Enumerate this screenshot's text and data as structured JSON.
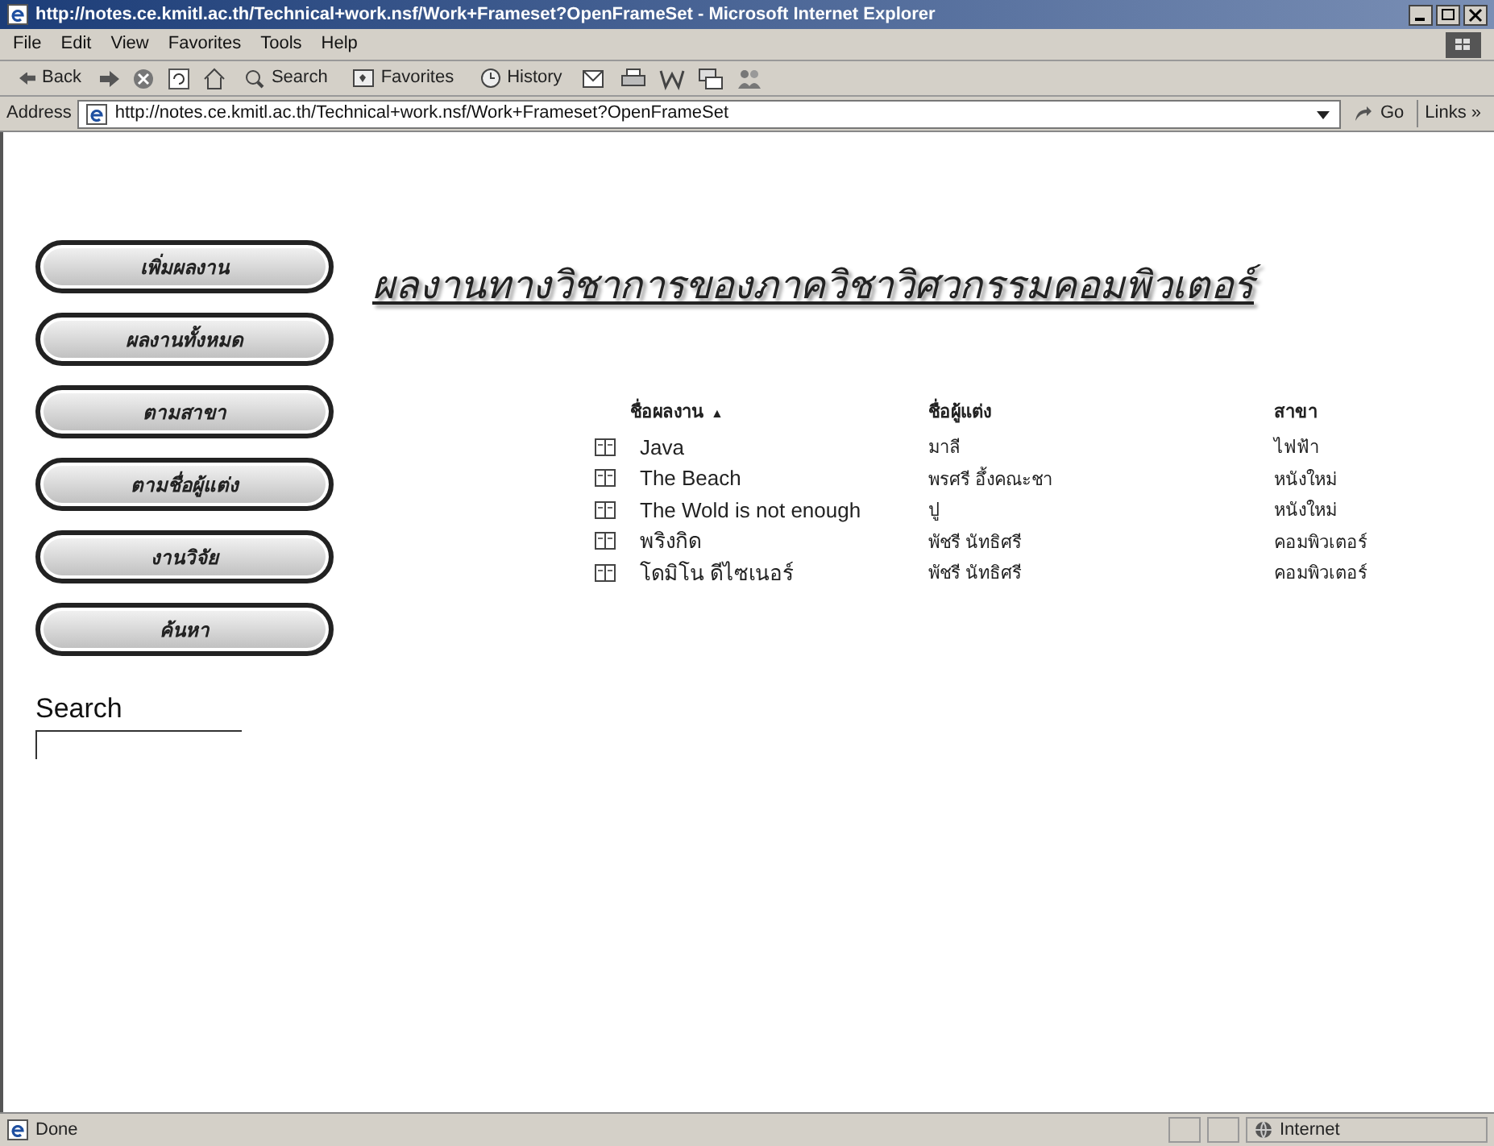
{
  "window": {
    "title": "http://notes.ce.kmitl.ac.th/Technical+work.nsf/Work+Frameset?OpenFrameSet - Microsoft Internet Explorer"
  },
  "menu": [
    "File",
    "Edit",
    "View",
    "Favorites",
    "Tools",
    "Help"
  ],
  "toolbar": {
    "back": "Back",
    "search": "Search",
    "favorites": "Favorites",
    "history": "History"
  },
  "address": {
    "label": "Address",
    "url": "http://notes.ce.kmitl.ac.th/Technical+work.nsf/Work+Frameset?OpenFrameSet",
    "go": "Go",
    "links": "Links »"
  },
  "nav_buttons": [
    "เพิ่มผลงาน",
    "ผลงานทั้งหมด",
    "ตามสาขา",
    "ตามชื่อผู้แต่ง",
    "งานวิจัย",
    "ค้นหา"
  ],
  "heading": "ผลงานทางวิชาการของภาควิชาวิศวกรรมคอมพิวเตอร์",
  "table": {
    "columns": [
      {
        "label": "ชื่อผลงาน",
        "sort": "▲"
      },
      {
        "label": "ชื่อผู้แต่ง"
      },
      {
        "label": "สาขา"
      }
    ],
    "rows": [
      {
        "title": "Java",
        "author": "มาลี",
        "field": "ไฟฟ้า"
      },
      {
        "title": "The Beach",
        "author": "พรศรี อึ้งคณะชา",
        "field": "หนังใหม่"
      },
      {
        "title": "The Wold is not enough",
        "author": "ปู",
        "field": "หนังใหม่"
      },
      {
        "title": "พริงกิด",
        "author": "พัชรี นัทธิศรี",
        "field": "คอมพิวเตอร์"
      },
      {
        "title": "โดมิโน ดีไซเนอร์",
        "author": "พัชรี นัทธิศรี",
        "field": "คอมพิวเตอร์"
      }
    ]
  },
  "search": {
    "label": "Search"
  },
  "status_bar": {
    "text": "Done",
    "zone": "Internet"
  }
}
